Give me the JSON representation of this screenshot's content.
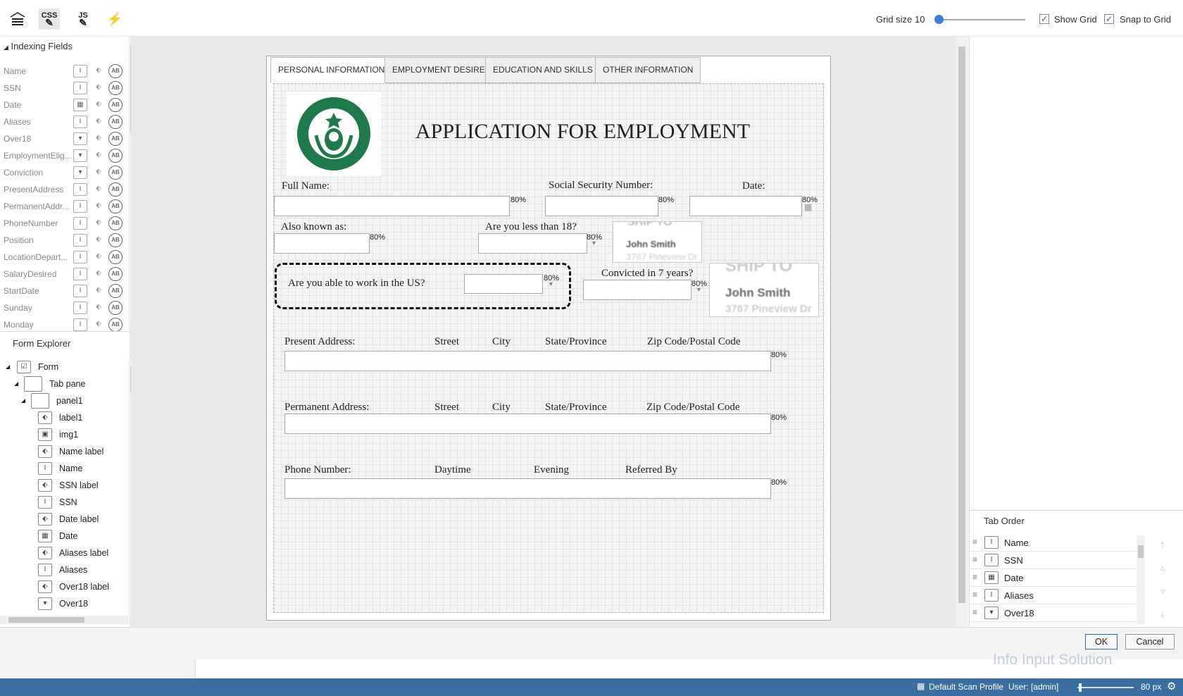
{
  "toolbar": {
    "css_label": "CSS",
    "js_label": "JS",
    "grid_size_label": "Grid size",
    "grid_size_value": "10",
    "show_grid_label": "Show Grid",
    "snap_to_grid_label": "Snap to Grid"
  },
  "indexing": {
    "title": "Indexing Fields",
    "fields": [
      "Name",
      "SSN",
      "Date",
      "Aliases",
      "Over18",
      "EmploymentElig...",
      "Conviction",
      "PresentAddress",
      "PermanentAddr...",
      "PhoneNumber",
      "Position",
      "LocationDepart...",
      "SalaryDesired",
      "StartDate",
      "Sunday",
      "Monday"
    ]
  },
  "explorer": {
    "title": "Form Explorer",
    "items": [
      {
        "label": "Form",
        "icon": "form-icon"
      },
      {
        "label": "Tab pane",
        "icon": "folder-icon"
      },
      {
        "label": "panel1",
        "icon": "folder-icon"
      },
      {
        "label": "label1",
        "icon": "label-icon"
      },
      {
        "label": "img1",
        "icon": "image-icon"
      },
      {
        "label": "Name label",
        "icon": "label-icon"
      },
      {
        "label": "Name",
        "icon": "text-field-icon"
      },
      {
        "label": "SSN label",
        "icon": "label-icon"
      },
      {
        "label": "SSN",
        "icon": "text-field-icon"
      },
      {
        "label": "Date label",
        "icon": "label-icon"
      },
      {
        "label": "Date",
        "icon": "calendar-icon"
      },
      {
        "label": "Aliases label",
        "icon": "label-icon"
      },
      {
        "label": "Aliases",
        "icon": "text-field-icon"
      },
      {
        "label": "Over18 label",
        "icon": "label-icon"
      },
      {
        "label": "Over18",
        "icon": "dropdown-icon"
      }
    ]
  },
  "form": {
    "tabs": [
      "PERSONAL INFORMATION",
      "EMPLOYMENT DESIRE",
      "EDUCATION AND SKILLS",
      "OTHER INFORMATION"
    ],
    "title": "APPLICATION FOR EMPLOYMENT",
    "labels": {
      "full_name": "Full Name:",
      "ssn": "Social Security Number:",
      "date": "Date:",
      "aka": "Also known as:",
      "under18": "Are you less than 18?",
      "work_us": "Are you able to work in the US?",
      "convicted": "Convicted in 7 years?",
      "present_address": "Present Address:",
      "permanent_address": "Permanent Address:",
      "street": "Street",
      "city": "City",
      "state": "State/Province",
      "zip": "Zip Code/Postal Code",
      "phone": "Phone Number:",
      "daytime": "Daytime",
      "evening": "Evening",
      "referred": "Referred By"
    },
    "confidence": "80%",
    "sample_name": "John Smith",
    "sample_ship": "SHIP TO",
    "sample_address": "3787 Pineview Dr"
  },
  "tab_order": {
    "title": "Tab Order",
    "items": [
      {
        "label": "Name",
        "icon": "text-field-icon"
      },
      {
        "label": "SSN",
        "icon": "text-field-icon"
      },
      {
        "label": "Date",
        "icon": "calendar-icon"
      },
      {
        "label": "Aliases",
        "icon": "text-field-icon"
      },
      {
        "label": "Over18",
        "icon": "dropdown-icon"
      }
    ]
  },
  "dialog": {
    "ok_label": "OK",
    "cancel_label": "Cancel"
  },
  "status": {
    "brand_text": "Info Input Solution",
    "profile_label": "Default Scan Profile",
    "user_label": "User: [admin]",
    "zoom_label": "80 px"
  }
}
